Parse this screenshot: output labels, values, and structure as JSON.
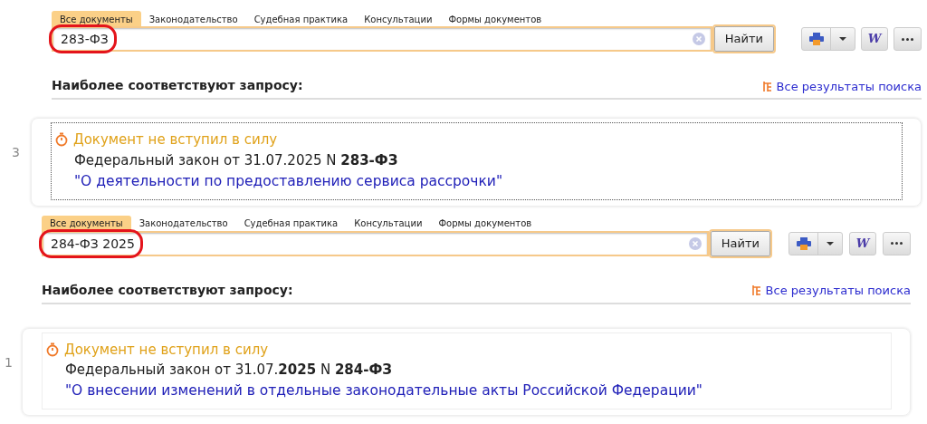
{
  "panels": [
    {
      "tabs": [
        {
          "label": "Все документы",
          "selected": true
        },
        {
          "label": "Законодательство",
          "selected": false
        },
        {
          "label": "Судебная практика",
          "selected": false
        },
        {
          "label": "Консультации",
          "selected": false
        },
        {
          "label": "Формы документов",
          "selected": false
        }
      ],
      "search": {
        "value": "283-ФЗ",
        "circled": true,
        "button": "Найти",
        "word_button": "W"
      },
      "heading": "Наиболее соответствуют запросу:",
      "all_results_link": "Все результаты поиска",
      "result": {
        "number": "3",
        "status": "Документ не вступил в силу",
        "description": "Федеральный закон от 31.07.2025 N **283-ФЗ**",
        "title": "\"О деятельности по предоставлению сервиса рассрочки\"",
        "focused": true
      }
    },
    {
      "tabs": [
        {
          "label": "Все документы",
          "selected": true
        },
        {
          "label": "Законодательство",
          "selected": false
        },
        {
          "label": "Судебная практика",
          "selected": false
        },
        {
          "label": "Консультации",
          "selected": false
        },
        {
          "label": "Формы документов",
          "selected": false
        }
      ],
      "search": {
        "value": "284-ФЗ 2025",
        "circled": true,
        "button": "Найти",
        "word_button": "W"
      },
      "heading": "Наиболее соответствуют запросу:",
      "all_results_link": "Все результаты поиска",
      "result": {
        "number": "1",
        "status": "Документ не вступил в силу",
        "description": "Федеральный закон от 31.07.**2025** N **284-ФЗ**",
        "title": "\"О внесении изменений в отдельные законодательные акты Российской Федерации\"",
        "focused": false
      }
    }
  ]
}
